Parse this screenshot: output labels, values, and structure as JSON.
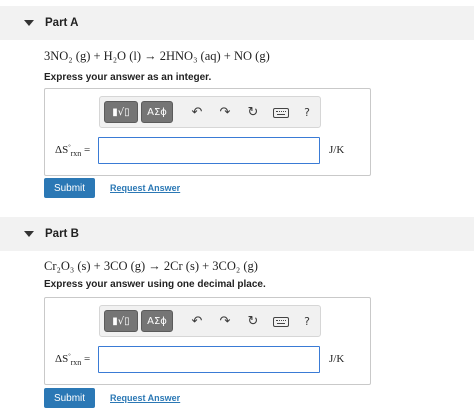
{
  "parts": [
    {
      "title": "Part A",
      "reaction": "3NO₂ (g) + H₂O (l) → 2HNO₃ (aq) + NO (g)",
      "instruction": "Express your answer as an integer.",
      "answer_value": "",
      "unit": "J/K",
      "submit": "Submit",
      "request": "Request Answer"
    },
    {
      "title": "Part B",
      "reaction": "Cr₂O₃ (s) + 3CO (g) → 2Cr (s) + 3CO₂ (g)",
      "instruction": "Express your answer using one decimal place.",
      "answer_value": "",
      "unit": "J/K",
      "submit": "Submit",
      "request": "Request Answer"
    }
  ],
  "toolbar": {
    "template_label": "▮√▯",
    "symbols_label": "ΑΣϕ",
    "undo_icon": "↶",
    "redo_icon": "↷",
    "reset_icon": "↻",
    "help_label": "?"
  },
  "lhs": {
    "delta_s": "ΔS",
    "superscript": "°",
    "subscript": "rxn",
    "equals": "="
  }
}
